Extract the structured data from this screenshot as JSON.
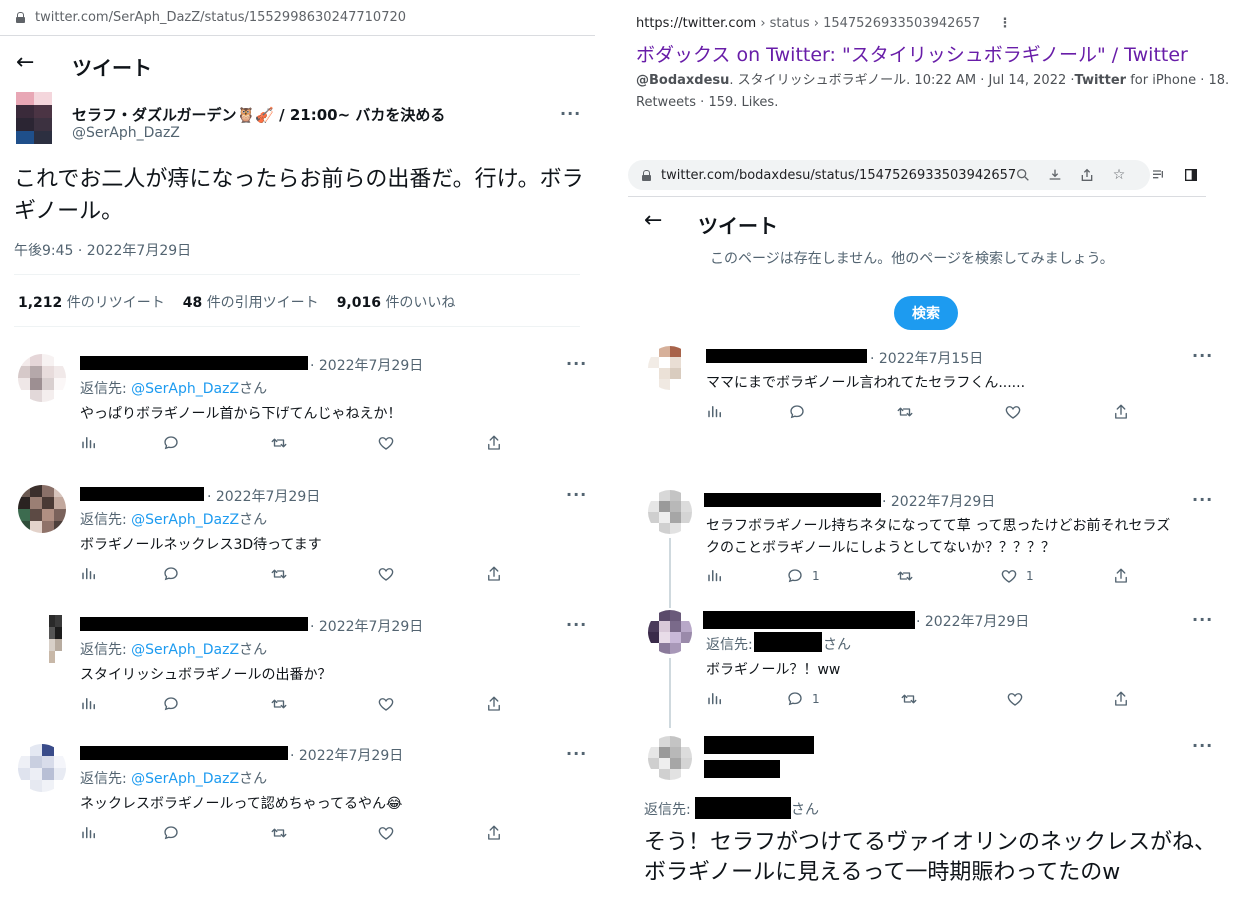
{
  "left": {
    "url": "twitter.com/SerAph_DazZ/status/1552998630247710720",
    "header_title": "ツイート",
    "author_name": "セラフ・ダズルガーデン🦉🎻 / 21:00~ バカを決める",
    "handle": "@SerAph_DazZ",
    "tweet_text": "これでお二人が痔になったらお前らの出番だ。行け。ボラギノール。",
    "timestamp": "午後9:45 · 2022年7月29日",
    "stats": {
      "retweets_num": "1,212",
      "retweets_label": "件のリツイート",
      "quotes_num": "48",
      "quotes_label": "件の引用ツイート",
      "likes_num": "9,016",
      "likes_label": "件のいいね"
    },
    "replies": [
      {
        "date": "· 2022年7月29日",
        "reply_prefix": "返信先: ",
        "reply_mention": "@SerAph_DazZ",
        "reply_suffix": "さん",
        "text": "やっぱりボラギノール首から下げてんじゃねえか！"
      },
      {
        "date": "· 2022年7月29日",
        "reply_prefix": "返信先: ",
        "reply_mention": "@SerAph_DazZ",
        "reply_suffix": "さん",
        "text": "ボラギノールネックレス3D待ってます"
      },
      {
        "date": "· 2022年7月29日",
        "reply_prefix": "返信先: ",
        "reply_mention": "@SerAph_DazZ",
        "reply_suffix": "さん",
        "text": "スタイリッシュボラギノールの出番か？"
      },
      {
        "date": "· 2022年7月29日",
        "reply_prefix": "返信先: ",
        "reply_mention": "@SerAph_DazZ",
        "reply_suffix": "さん",
        "text": "ネックレスボラギノールって認めちゃってるやん😂"
      }
    ]
  },
  "right": {
    "result_url": "https://twitter.com",
    "result_crumb": "› status › 1547526933503942657",
    "result_title": "ボダックス on Twitter: \"スタイリッシュボラギノール\" / Twitter",
    "snippet_handle": "@Bodaxdesu",
    "snippet_rest_1": ". スタイリッシュボラギノール. 10:22 AM · Jul 14, 2022 ·",
    "snippet_twitter": "Twitter",
    "snippet_rest_2": " for iPhone · 18. Retweets · 159. Likes.",
    "browser_url": "twitter.com/bodaxdesu/status/1547526933503942657",
    "header_title": "ツイート",
    "not_found": "このページは存在しません。他のページを検索してみましょう。",
    "search_button": "検索",
    "replies": [
      {
        "date": "· 2022年7月15日",
        "text": "ママにまでボラギノール言われてたセラフくん......"
      },
      {
        "date": "· 2022年7月29日",
        "text_line1": "セラフボラギノール持ちネタになってて草 って思ったけどお前それセラズ",
        "text_line2": "クのことボラギノールにしようとしてないか？？？？？",
        "reply_count": "1",
        "like_count": "1"
      },
      {
        "date": "· 2022年7月29日",
        "reply_prefix": "返信先:",
        "reply_suffix": "さん",
        "text": "ボラギノール？！ww",
        "reply_count": "1"
      },
      {
        "reply_prefix": "返信先:",
        "reply_suffix": "さん",
        "big_text": "そう！セラフがつけてるヴァイオリンのネックレスがね、ボラギノールに見えるって一時期賑わってたのw"
      }
    ]
  },
  "icons": [
    "lock-icon",
    "back-arrow-icon",
    "more-icon",
    "views-icon",
    "reply-icon",
    "retweet-icon",
    "like-icon",
    "share-icon",
    "search-icon",
    "download-icon",
    "share-page-icon",
    "star-icon",
    "media-icon",
    "sidepanel-icon"
  ]
}
